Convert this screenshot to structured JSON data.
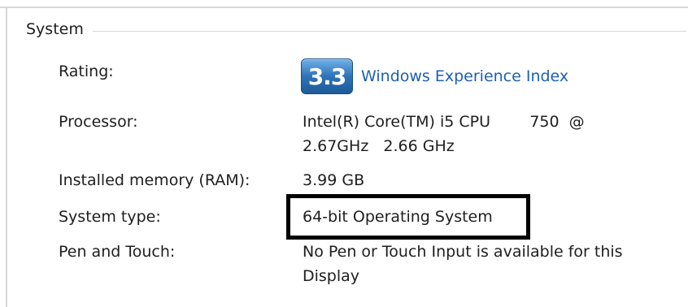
{
  "group": {
    "title": "System"
  },
  "rating": {
    "label": "Rating:",
    "score": "3.3",
    "link_text": "Windows Experience Index"
  },
  "processor": {
    "label": "Processor:",
    "value_line1": "Intel(R) Core(TM) i5 CPU        750  @",
    "value_line2": "2.67GHz   2.66 GHz"
  },
  "memory": {
    "label": "Installed memory (RAM):",
    "value": "3.99 GB"
  },
  "system_type": {
    "label": "System type:",
    "value": "64-bit Operating System"
  },
  "pen_touch": {
    "label": "Pen and Touch:",
    "value_line1": "No Pen or Touch Input is available for this",
    "value_line2": "Display"
  },
  "colors": {
    "link": "#1c5fb4",
    "badge": "#2f74b8",
    "highlight": "#000000"
  }
}
